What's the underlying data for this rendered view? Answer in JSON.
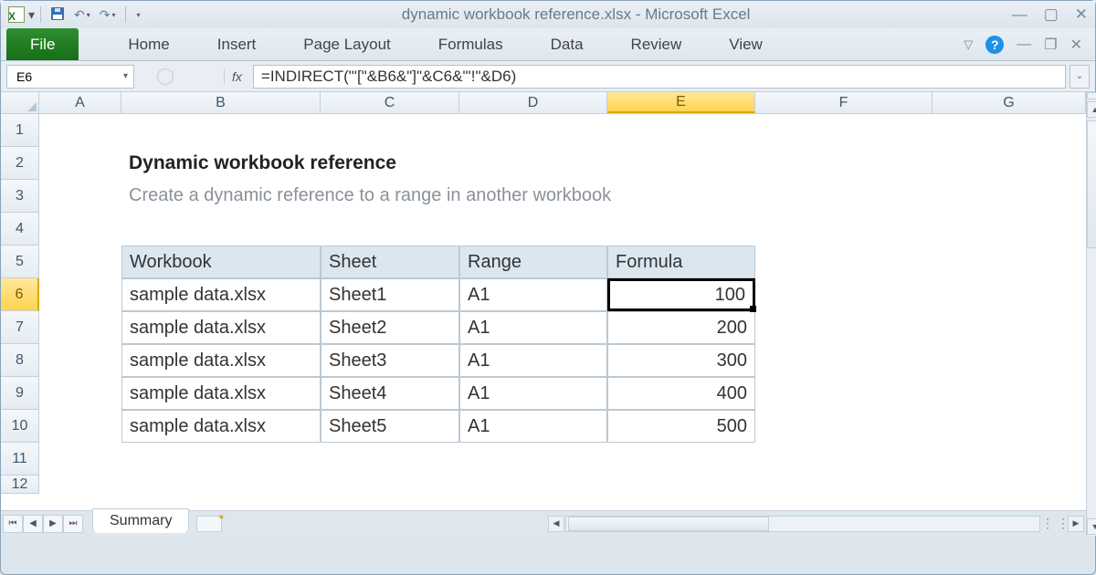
{
  "titlebar": {
    "document": "dynamic workbook reference.xlsx",
    "app": "Microsoft Excel"
  },
  "ribbon": {
    "file": "File",
    "tabs": [
      "Home",
      "Insert",
      "Page Layout",
      "Formulas",
      "Data",
      "Review",
      "View"
    ]
  },
  "namebox": "E6",
  "fx_label": "fx",
  "formula": "=INDIRECT(\"'[\"&B6&\"]\"&C6&\"'!\"&D6)",
  "columns": [
    "A",
    "B",
    "C",
    "D",
    "E",
    "F",
    "G"
  ],
  "active_col": "E",
  "row_numbers": [
    1,
    2,
    3,
    4,
    5,
    6,
    7,
    8,
    9,
    10,
    11,
    12
  ],
  "active_row": 6,
  "content": {
    "title": "Dynamic workbook reference",
    "subtitle": "Create a dynamic reference to a range in another workbook"
  },
  "table": {
    "headers": [
      "Workbook",
      "Sheet",
      "Range",
      "Formula"
    ],
    "rows": [
      {
        "workbook": "sample data.xlsx",
        "sheet": "Sheet1",
        "range": "A1",
        "formula": "100"
      },
      {
        "workbook": "sample data.xlsx",
        "sheet": "Sheet2",
        "range": "A1",
        "formula": "200"
      },
      {
        "workbook": "sample data.xlsx",
        "sheet": "Sheet3",
        "range": "A1",
        "formula": "300"
      },
      {
        "workbook": "sample data.xlsx",
        "sheet": "Sheet4",
        "range": "A1",
        "formula": "400"
      },
      {
        "workbook": "sample data.xlsx",
        "sheet": "Sheet5",
        "range": "A1",
        "formula": "500"
      }
    ]
  },
  "sheet_tab": "Summary"
}
